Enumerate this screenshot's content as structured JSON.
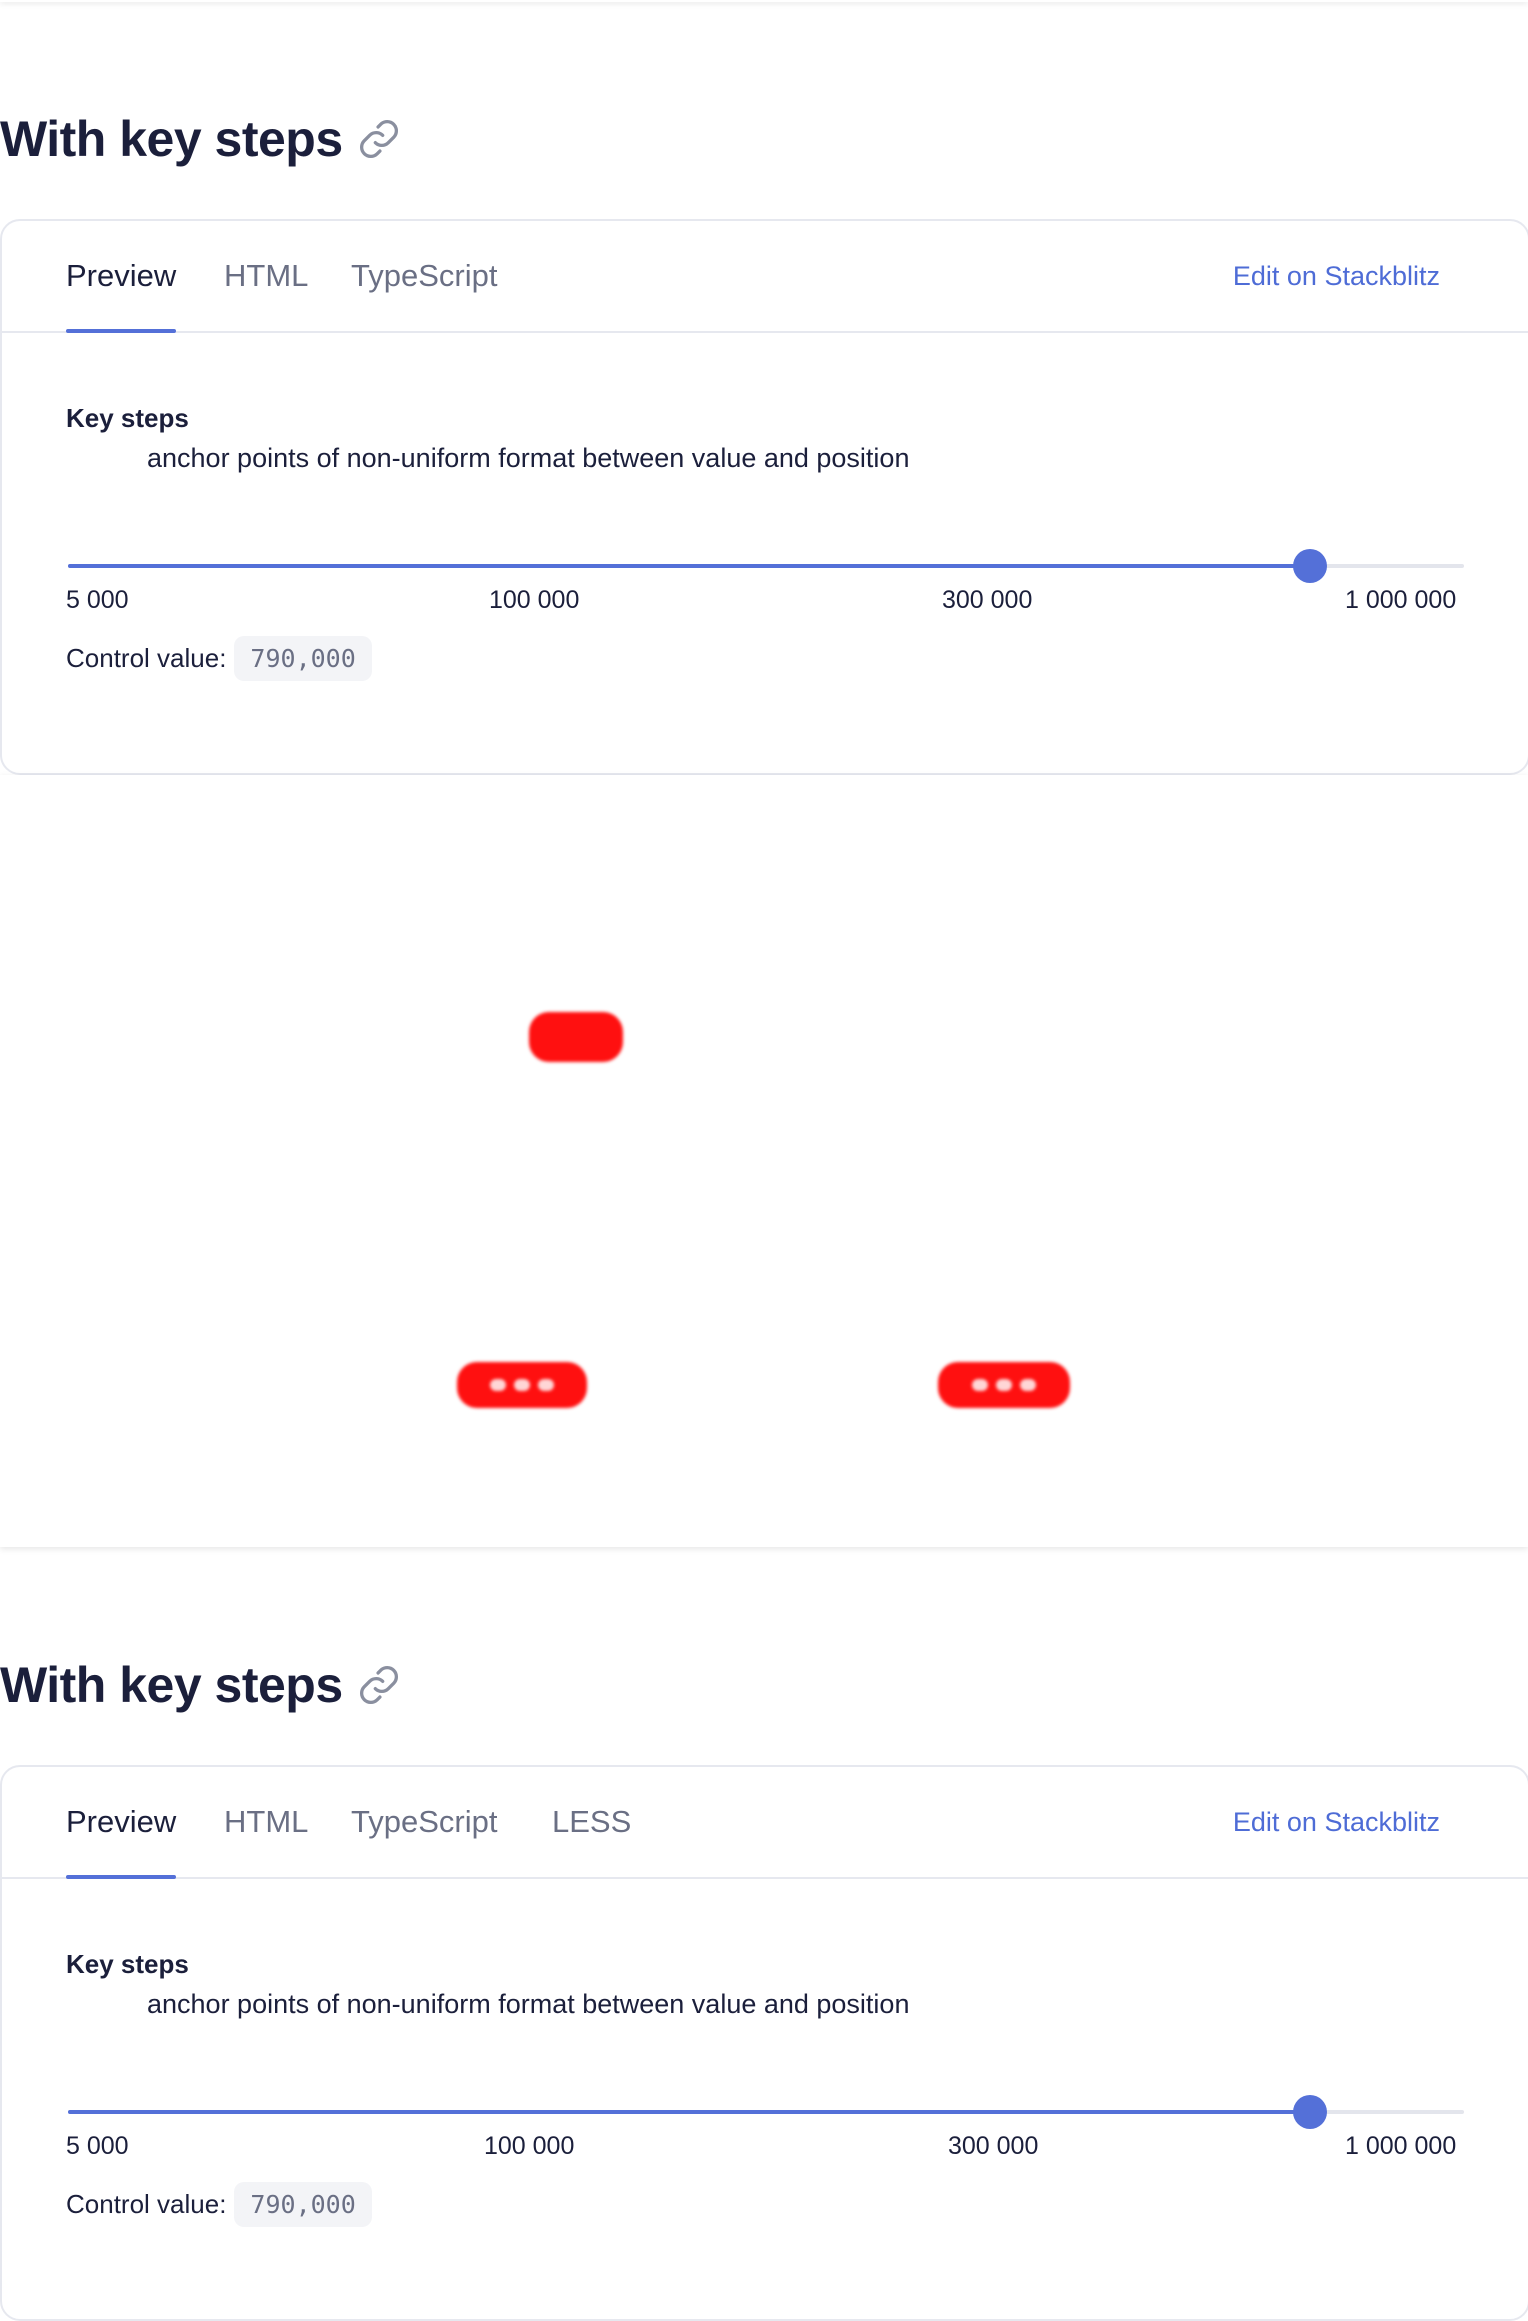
{
  "sections": [
    {
      "title": "With key steps",
      "tabs": [
        "Preview",
        "HTML",
        "TypeScript"
      ],
      "active_tab": "Preview",
      "edit_link": "Edit on Stackblitz",
      "label_title": "Key steps",
      "label_desc": "anchor points of non-uniform format between value and position",
      "ticks": [
        "5 000",
        "100 000",
        "300 000",
        "1 000 000"
      ],
      "slider_fraction": 0.89,
      "control_label": "Control value:",
      "control_value": "790,000"
    },
    {
      "title": "With key steps",
      "tabs": [
        "Preview",
        "HTML",
        "TypeScript",
        "LESS"
      ],
      "active_tab": "Preview",
      "edit_link": "Edit on Stackblitz",
      "label_title": "Key steps",
      "label_desc": "anchor points of non-uniform format between value and position",
      "ticks": [
        "5 000",
        "100 000",
        "300 000",
        "1 000 000"
      ],
      "slider_fraction": 0.89,
      "control_label": "Control value:",
      "control_value": "790,000"
    }
  ],
  "icons": {
    "anchor": "link-icon"
  },
  "colors": {
    "accent": "#5470d8",
    "link": "#4e6cd6",
    "text": "#1b1f3b",
    "muted": "#6a6f84",
    "ad_placeholder": "#ff1010"
  }
}
